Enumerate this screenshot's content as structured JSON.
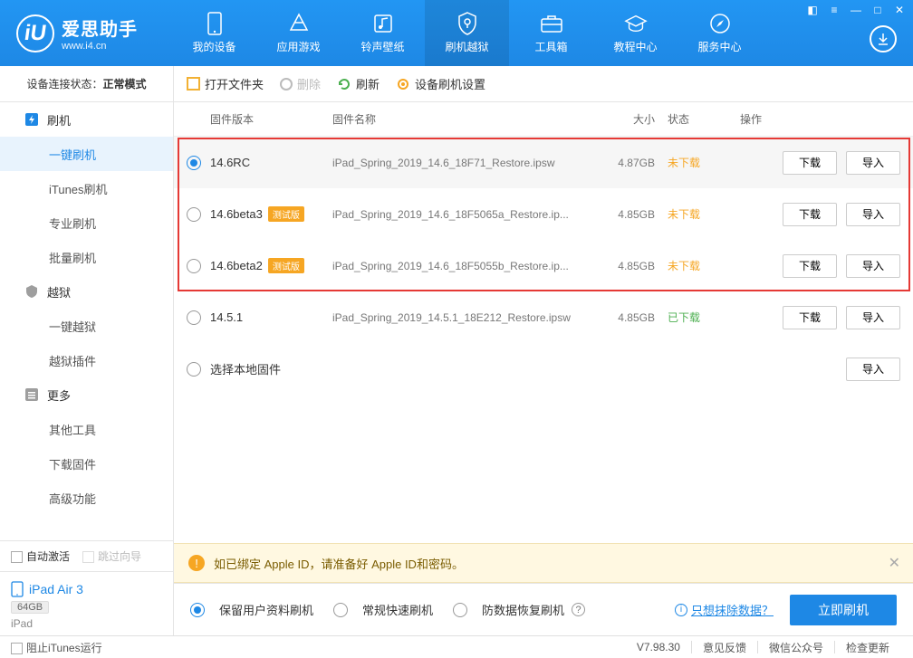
{
  "app": {
    "name": "爱思助手",
    "url": "www.i4.cn"
  },
  "nav": {
    "items": [
      "我的设备",
      "应用游戏",
      "铃声壁纸",
      "刷机越狱",
      "工具箱",
      "教程中心",
      "服务中心"
    ]
  },
  "sidebar": {
    "conn_label": "设备连接状态：",
    "conn_value": "正常模式",
    "groups": {
      "flash": "刷机",
      "jailbreak": "越狱",
      "more": "更多"
    },
    "items": {
      "oneclick_flash": "一键刷机",
      "itunes_flash": "iTunes刷机",
      "pro_flash": "专业刷机",
      "batch_flash": "批量刷机",
      "oneclick_jb": "一键越狱",
      "jb_plugins": "越狱插件",
      "other_tools": "其他工具",
      "dl_firmware": "下载固件",
      "adv_features": "高级功能"
    },
    "auto_activate": "自动激活",
    "skip_wizard": "跳过向导",
    "device": {
      "name": "iPad Air 3",
      "storage": "64GB",
      "type": "iPad"
    }
  },
  "toolbar": {
    "open": "打开文件夹",
    "delete": "删除",
    "refresh": "刷新",
    "settings": "设备刷机设置"
  },
  "table": {
    "headers": {
      "version": "固件版本",
      "name": "固件名称",
      "size": "大小",
      "status": "状态",
      "ops": "操作"
    },
    "status_undl": "未下载",
    "status_dl": "已下载",
    "download_btn": "下载",
    "import_btn": "导入",
    "beta_tag": "测试版",
    "local_firmware": "选择本地固件",
    "rows": [
      {
        "ver": "14.6RC",
        "beta": false,
        "name": "iPad_Spring_2019_14.6_18F71_Restore.ipsw",
        "size": "4.87GB",
        "status": "undl"
      },
      {
        "ver": "14.6beta3",
        "beta": true,
        "name": "iPad_Spring_2019_14.6_18F5065a_Restore.ip...",
        "size": "4.85GB",
        "status": "undl"
      },
      {
        "ver": "14.6beta2",
        "beta": true,
        "name": "iPad_Spring_2019_14.6_18F5055b_Restore.ip...",
        "size": "4.85GB",
        "status": "undl"
      },
      {
        "ver": "14.5.1",
        "beta": false,
        "name": "iPad_Spring_2019_14.5.1_18E212_Restore.ipsw",
        "size": "4.85GB",
        "status": "dl"
      }
    ]
  },
  "alert": "如已绑定 Apple ID，请准备好 Apple ID和密码。",
  "flash": {
    "opt_keep": "保留用户资料刷机",
    "opt_fast": "常规快速刷机",
    "opt_anti": "防数据恢复刷机",
    "erase_link": "只想抹除数据？",
    "button": "立即刷机"
  },
  "footer": {
    "block_itunes": "阻止iTunes运行",
    "version": "V7.98.30",
    "feedback": "意见反馈",
    "wechat": "微信公众号",
    "check_update": "检查更新"
  }
}
